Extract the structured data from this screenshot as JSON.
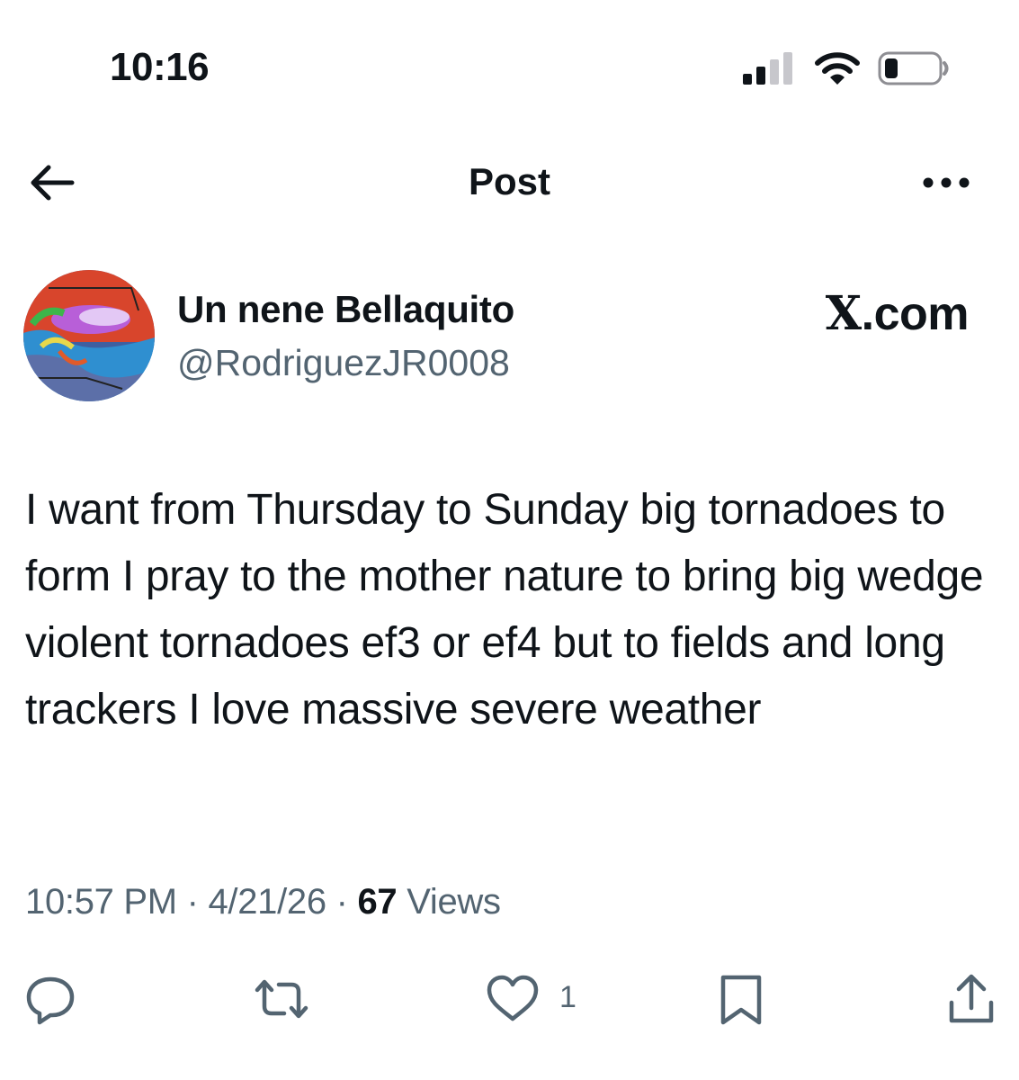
{
  "status_bar": {
    "time": "10:16",
    "signal_icon": "cellular-signal-icon",
    "wifi_icon": "wifi-icon",
    "battery_icon": "battery-icon"
  },
  "header": {
    "title": "Post",
    "back_icon": "arrow-left-icon",
    "more_icon": "more-horizontal-icon"
  },
  "post": {
    "author": {
      "display_name": "Un nene Bellaquito",
      "handle": "@RodriguezJR0008"
    },
    "watermark": {
      "x": "X",
      "domain": ".com"
    },
    "text": "I want from Thursday to Sunday big tornadoes to form I pray to the mother nature to bring big wedge violent tornadoes ef3 or ef4 but to fields and long trackers I love massive severe weather",
    "meta": {
      "time": "10:57 PM",
      "separator": " · ",
      "date": "4/21/26",
      "views_count": "67",
      "views_label": " Views"
    },
    "actions": {
      "reply_icon": "reply-icon",
      "repost_icon": "repost-icon",
      "like_icon": "heart-icon",
      "like_count": "1",
      "bookmark_icon": "bookmark-icon",
      "share_icon": "share-icon"
    }
  },
  "colors": {
    "text_primary": "#0f1419",
    "text_secondary": "#536471",
    "background": "#ffffff"
  }
}
